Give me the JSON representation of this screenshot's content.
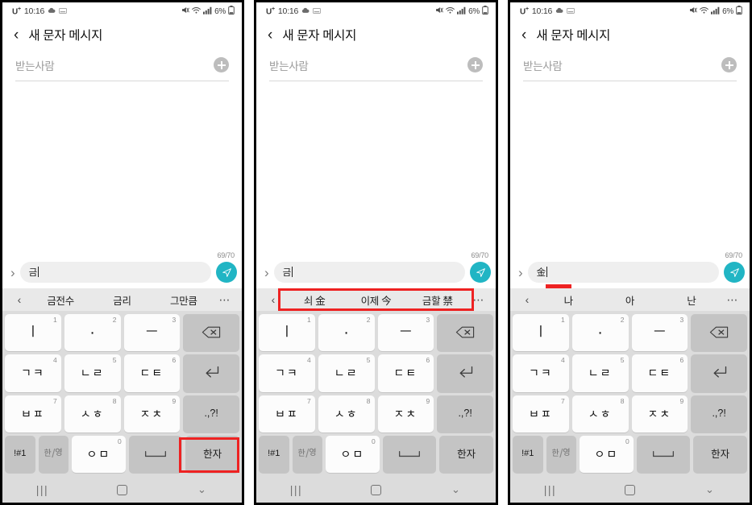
{
  "statusbar": {
    "carrier": "U",
    "carrier_sup": "+",
    "time": "10:16",
    "icons_left": [
      "cloud-icon",
      "keyboard-icon"
    ],
    "icons_right": [
      "mute-icon",
      "wifi-icon",
      "signal-icon"
    ],
    "battery_text": "6%",
    "battery_icon": "battery-icon"
  },
  "header": {
    "back_icon": "‹",
    "title": "새 문자 메시지"
  },
  "recipient": {
    "placeholder": "받는사람",
    "add_icon": "plus-icon"
  },
  "compose": {
    "counter": "69/70",
    "expand_icon": "›",
    "send_icon": "send-icon",
    "send_color": "#21b5c4"
  },
  "panels": [
    {
      "id": "panel-1",
      "input_text": "금",
      "input_underline": false,
      "suggestions": [
        "금전수",
        "금리",
        "그만큼"
      ],
      "suggestion_highlighted": false,
      "hanja_key_highlighted": true
    },
    {
      "id": "panel-2",
      "input_text": "금",
      "input_underline": false,
      "suggestions": [
        "쇠 金",
        "이제 今",
        "금할 禁"
      ],
      "suggestion_highlighted": true,
      "hanja_key_highlighted": false
    },
    {
      "id": "panel-3",
      "input_text": "金",
      "input_underline": true,
      "suggestions": [
        "나",
        "아",
        "난"
      ],
      "suggestion_highlighted": false,
      "hanja_key_highlighted": false
    }
  ],
  "suggbar": {
    "prev_icon": "‹",
    "more_icon": "⋯",
    "background": "#e9e9e9",
    "highlight_color": "#ee2222"
  },
  "keyboard": {
    "background": "#dcdcdc",
    "rows": [
      [
        {
          "glyph": "ㅣ",
          "num": "1",
          "type": "normal",
          "style": "bar"
        },
        {
          "glyph": "·",
          "num": "2",
          "type": "normal",
          "style": "dot"
        },
        {
          "glyph": "ㅡ",
          "num": "3",
          "type": "normal",
          "style": "bar"
        },
        {
          "glyph": "backspace-icon",
          "num": "",
          "type": "fn",
          "style": "icon"
        }
      ],
      [
        {
          "glyph": "ㄱㅋ",
          "num": "4",
          "type": "normal",
          "style": "text"
        },
        {
          "glyph": "ㄴㄹ",
          "num": "5",
          "type": "normal",
          "style": "text"
        },
        {
          "glyph": "ㄷㅌ",
          "num": "6",
          "type": "normal",
          "style": "text"
        },
        {
          "glyph": "enter-icon",
          "num": "",
          "type": "fn",
          "style": "icon"
        }
      ],
      [
        {
          "glyph": "ㅂㅍ",
          "num": "7",
          "type": "normal",
          "style": "text"
        },
        {
          "glyph": "ㅅㅎ",
          "num": "8",
          "type": "normal",
          "style": "text"
        },
        {
          "glyph": "ㅈㅊ",
          "num": "9",
          "type": "normal",
          "style": "text"
        },
        {
          "glyph": ".,?!",
          "num": "",
          "type": "fn",
          "style": "small"
        }
      ],
      [
        {
          "glyph": "!#1",
          "num": "",
          "type": "fn",
          "style": "tiny",
          "flex": "0.62"
        },
        {
          "glyph": "lang-toggle-icon",
          "num": "",
          "type": "fn",
          "style": "lang",
          "flex": "0.62"
        },
        {
          "glyph": "ㅇㅁ",
          "num": "0",
          "type": "normal",
          "style": "text",
          "flex": "1.1"
        },
        {
          "glyph": "space-icon",
          "num": "",
          "type": "fn",
          "style": "icon",
          "flex": "1.1"
        },
        {
          "glyph": "한자",
          "num": "",
          "type": "fn",
          "style": "small",
          "flex": "1.1"
        }
      ]
    ],
    "lang_key": {
      "ko": "한",
      "slash": "/",
      "en": "영"
    }
  },
  "navbar": {
    "recent_icon": "|||",
    "home_icon": "○",
    "hide_keyboard_icon": "⌄"
  }
}
